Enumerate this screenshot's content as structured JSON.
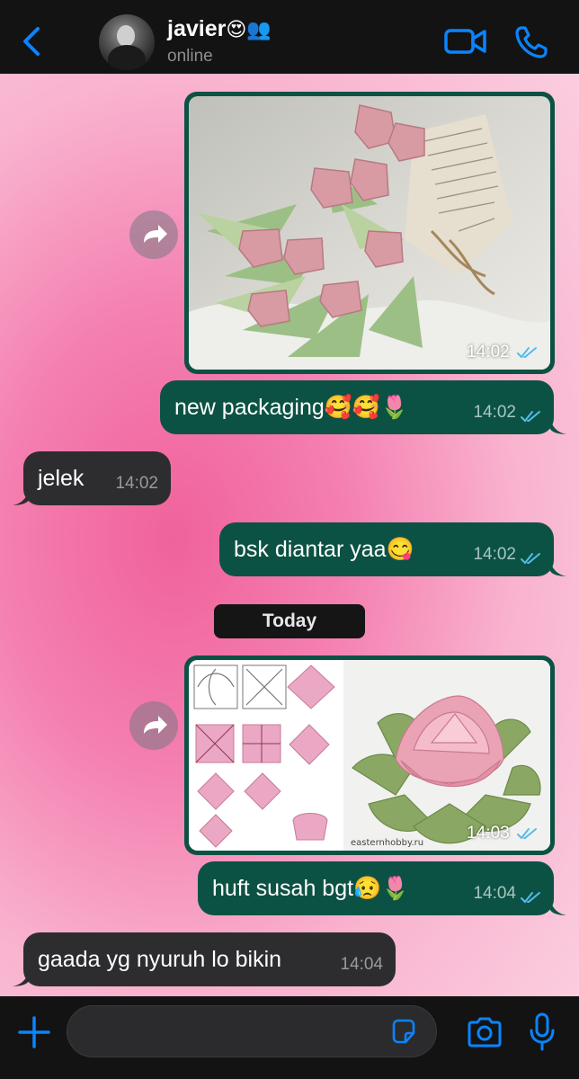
{
  "header": {
    "contact_name": "javier",
    "contact_emojis": "😍👥",
    "status": "online",
    "icons": {
      "back": "chevron-left-icon",
      "video": "video-camera-icon",
      "call": "phone-icon"
    },
    "accent_color": "#0a84ff"
  },
  "messages": {
    "m1": {
      "type": "image",
      "direction": "outgoing",
      "image": "origami-tulip-bouquet",
      "time": "14:02",
      "status": "read"
    },
    "m2": {
      "type": "text",
      "direction": "outgoing",
      "text": "new packaging🥰🥰🌷",
      "time": "14:02",
      "status": "read"
    },
    "m3": {
      "type": "text",
      "direction": "incoming",
      "text": "jelek",
      "time": "14:02"
    },
    "m4": {
      "type": "text",
      "direction": "outgoing",
      "text": "bsk diantar yaa😋",
      "time": "14:02",
      "status": "read"
    },
    "date_separator": "Today",
    "m5": {
      "type": "image",
      "direction": "outgoing",
      "image": "origami-lotus-instructions",
      "watermark": "easternhobby.ru",
      "time": "14:03",
      "status": "read"
    },
    "m6": {
      "type": "text",
      "direction": "outgoing",
      "text": "huft susah bgt😥🌷",
      "time": "14:04",
      "status": "read"
    },
    "m7": {
      "type": "text",
      "direction": "incoming",
      "text": "gaada yg nyuruh lo bikin",
      "time": "14:04"
    }
  },
  "input_bar": {
    "placeholder": "",
    "icons": {
      "attach": "plus-icon",
      "sticker": "sticker-icon",
      "camera": "camera-icon",
      "mic": "microphone-icon"
    }
  },
  "colors": {
    "outgoing_bubble": "#0c5244",
    "incoming_bubble": "#2d2d2f",
    "read_tick": "#53bdeb",
    "background": "#f47fb0"
  }
}
